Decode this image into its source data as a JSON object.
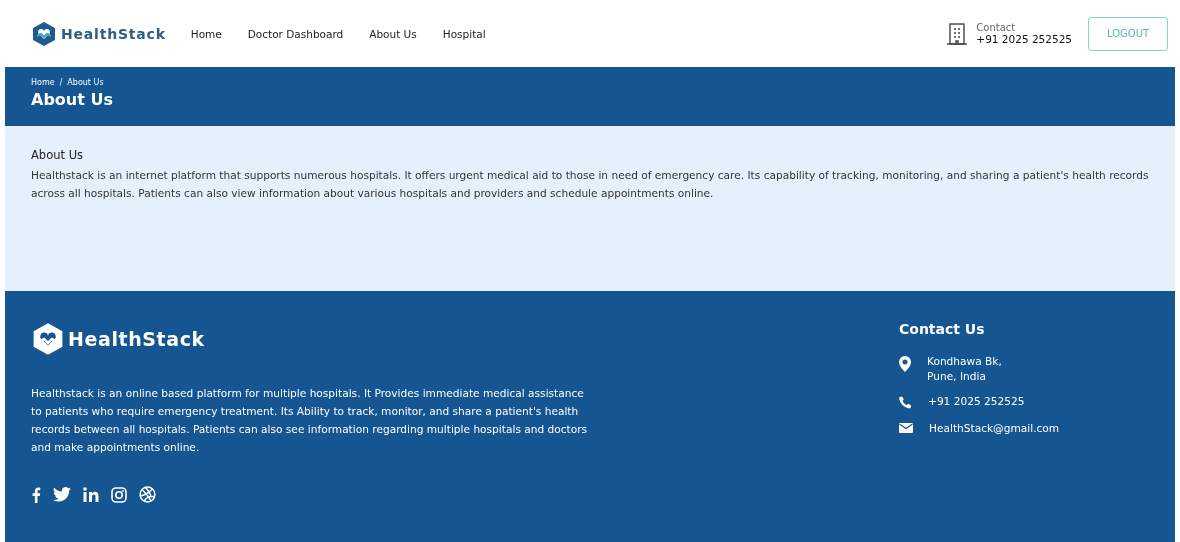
{
  "header": {
    "brand": "HealthStack",
    "nav": [
      {
        "label": "Home"
      },
      {
        "label": "Doctor Dashboard"
      },
      {
        "label": "About Us"
      },
      {
        "label": "Hospital"
      }
    ],
    "contact_label": "Contact",
    "contact_phone": "+91 2025 252525",
    "logout": "LOGOUT"
  },
  "banner": {
    "breadcrumb": [
      "Home",
      "About Us"
    ],
    "separator": "/",
    "title": "About Us"
  },
  "about": {
    "heading": "About Us",
    "text": "Healthstack is an internet platform that supports numerous hospitals. It offers urgent medical aid to those in need of emergency care. Its capability of tracking, monitoring, and sharing a patient's health records across all hospitals. Patients can also view information about various hospitals and providers and schedule appointments online."
  },
  "footer": {
    "brand": "HealthStack",
    "text": "Healthstack is an online based platform for multiple hospitals. It Provides immediate medical assistance to patients who require emergency treatment. Its Ability to track, monitor, and share a patient's health records between all hospitals. Patients can also see information regarding multiple hospitals and doctors and make appointments online.",
    "contact_heading": "Contact Us",
    "contacts": [
      {
        "kind": "address",
        "lines": [
          "Kondhawa Bk,",
          "Pune, India"
        ]
      },
      {
        "kind": "phone",
        "lines": [
          "+91 2025 252525"
        ]
      },
      {
        "kind": "email",
        "lines": [
          "HealthStack@gmail.com"
        ]
      }
    ]
  }
}
